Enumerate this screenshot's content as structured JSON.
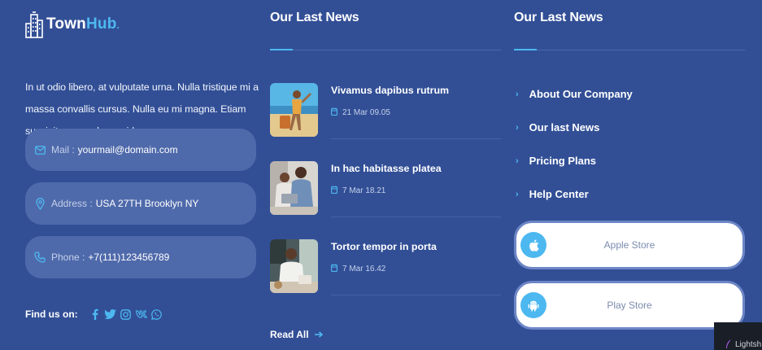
{
  "logo": {
    "text_a": "Town",
    "text_b": "Hub",
    "dot": "."
  },
  "about": "In ut odio libero, at vulputate urna. Nulla tristique mi a massa convallis cursus. Nulla eu mi magna. Etiam suscipit commodo gravida.",
  "contacts": [
    {
      "icon": "mail-icon",
      "label": "Mail :",
      "value": "yourmail@domain.com"
    },
    {
      "icon": "location-pin-icon",
      "label": "Address :",
      "value": "USA 27TH Brooklyn NY"
    },
    {
      "icon": "phone-icon",
      "label": "Phone :",
      "value": "+7(111)123456789"
    }
  ],
  "social": {
    "label": "Find us on:",
    "icons": [
      "facebook-icon",
      "twitter-icon",
      "instagram-icon",
      "vk-icon",
      "whatsapp-icon"
    ]
  },
  "news": {
    "heading": "Our Last News",
    "items": [
      {
        "title": "Vivamus dapibus rutrum",
        "date": "21 Mar 09.05"
      },
      {
        "title": "In hac habitasse platea",
        "date": "7 Mar 18.21"
      },
      {
        "title": "Tortor tempor in porta",
        "date": "7 Mar 16.42"
      }
    ],
    "read_all": "Read All"
  },
  "links": {
    "heading": "Our Last News",
    "items": [
      "About Our Company",
      "Our last News",
      "Pricing Plans",
      "Help Center"
    ]
  },
  "stores": [
    {
      "icon": "apple-icon",
      "label": "Apple Store"
    },
    {
      "icon": "android-icon",
      "label": "Play Store"
    }
  ],
  "corner_text": "Lightsh",
  "colors": {
    "background": "#324f96",
    "accent": "#4db8f0",
    "card": "#4f6aab"
  }
}
